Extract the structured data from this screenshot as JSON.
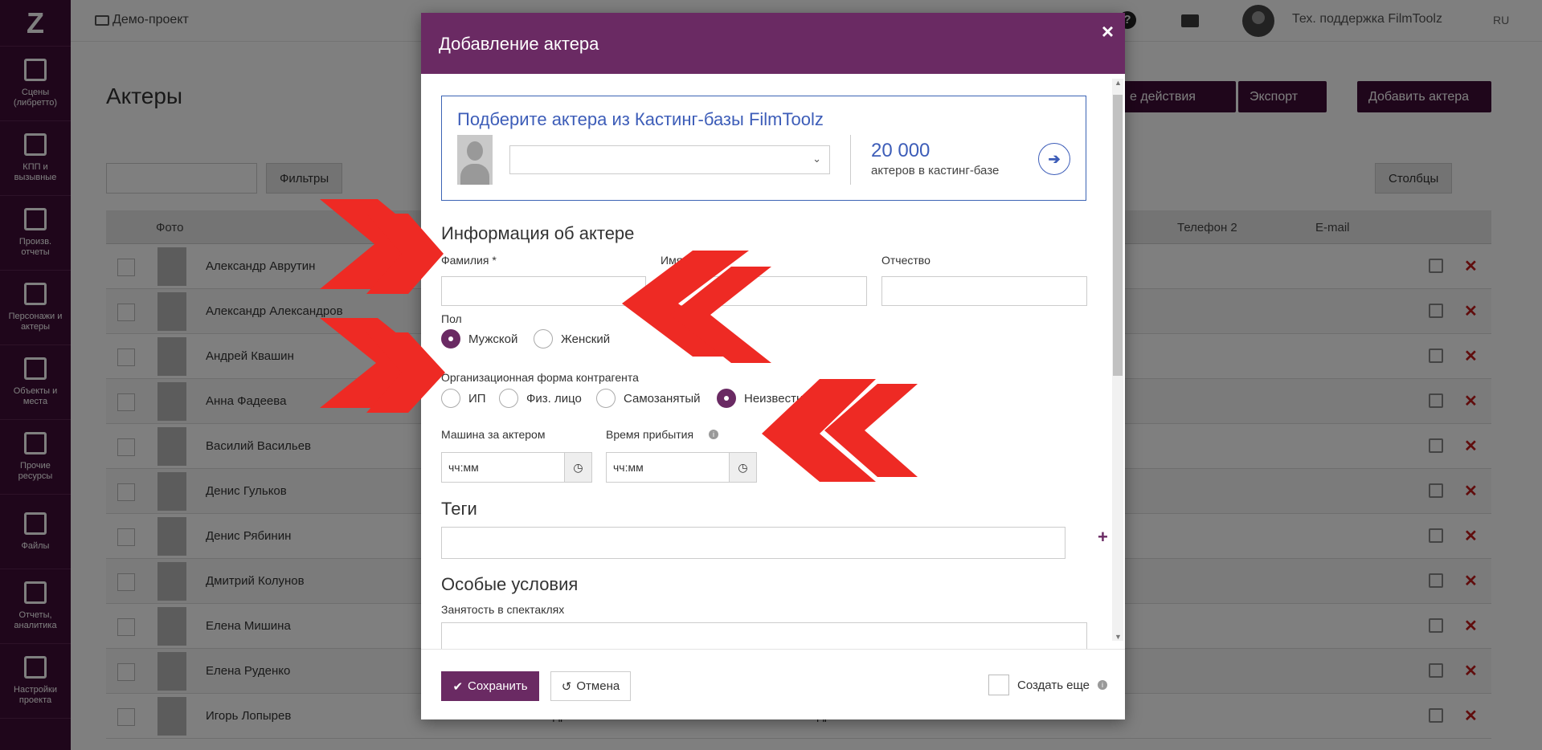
{
  "sidebar": {
    "logo": "Z",
    "items": [
      {
        "label": "Сцены\n(либретто)",
        "icon": "clapperboard-icon"
      },
      {
        "label": "КПП и\nвызывные",
        "icon": "calendar-icon"
      },
      {
        "label": "Произв.\nотчеты",
        "icon": "check-icon"
      },
      {
        "label": "Персонажи и\nактеры",
        "icon": "people-icon"
      },
      {
        "label": "Объекты и\nместа",
        "icon": "image-icon"
      },
      {
        "label": "Прочие\nресурсы",
        "icon": "archive-icon"
      },
      {
        "label": "Файлы",
        "icon": "file-icon"
      },
      {
        "label": "Отчеты,\nаналитика",
        "icon": "bar-chart-icon"
      },
      {
        "label": "Настройки\nпроекта",
        "icon": "sliders-icon"
      }
    ]
  },
  "topbar": {
    "project": "Демо-проект",
    "help": "?",
    "user": "Тех. поддержка FilmToolz",
    "lang": "RU"
  },
  "page": {
    "title": "Актеры",
    "group_actions": "е действия",
    "export": "Экспорт",
    "add_actor": "Добавить актера",
    "filters": "Фильтры",
    "columns": "Столбцы",
    "table_headers": {
      "photo": "Фото",
      "phone2": "Телефон 2",
      "email": "E-mail"
    },
    "rows": [
      "Александр Аврутин",
      "Александр Александров",
      "Андрей Квашин",
      "Анна Фадеева",
      "Василий Васильев",
      "Денис Гульков",
      "Денис Рябинин",
      "Дмитрий Колунов",
      "Елена Мишина",
      "Елена Руденко",
      "Игорь Лопырев"
    ],
    "last_row_extra": [
      "Томое андрее",
      "Отнодрическая"
    ]
  },
  "modal": {
    "title": "Добавление актера",
    "close": "×",
    "casting": {
      "title": "Подберите актера из Кастинг-базы FilmToolz",
      "select_value": "",
      "count": "20 000",
      "count_label": "актеров в кастинг-базе",
      "go": "➔"
    },
    "info_title": "Информация об актере",
    "fields": {
      "surname": "Фамилия",
      "surname_req": "*",
      "name": "Имя",
      "patronymic": "Отчество"
    },
    "gender": {
      "label": "Пол",
      "options": [
        "Мужской",
        "Женский"
      ],
      "selected": "Мужской"
    },
    "org_form": {
      "label": "Организационная форма контрагента",
      "options": [
        "ИП",
        "Физ. лицо",
        "Самозанятый",
        "Неизвестно"
      ],
      "selected": "Неизвестно"
    },
    "car": {
      "label": "Машина за актером",
      "placeholder": "чч:мм"
    },
    "arrival": {
      "label": "Время прибытия",
      "placeholder": "чч:мм"
    },
    "tags_title": "Теги",
    "special_title": "Особые условия",
    "busy_label": "Занятость в спектаклях",
    "save": "Сохранить",
    "cancel": "Отмена",
    "create_more": "Создать еще"
  },
  "colors": {
    "sidebar": "#3f0d36",
    "modal_header": "#6a2a63",
    "accent_blue": "#3d5db8",
    "arrow_red": "#ee2a24"
  }
}
